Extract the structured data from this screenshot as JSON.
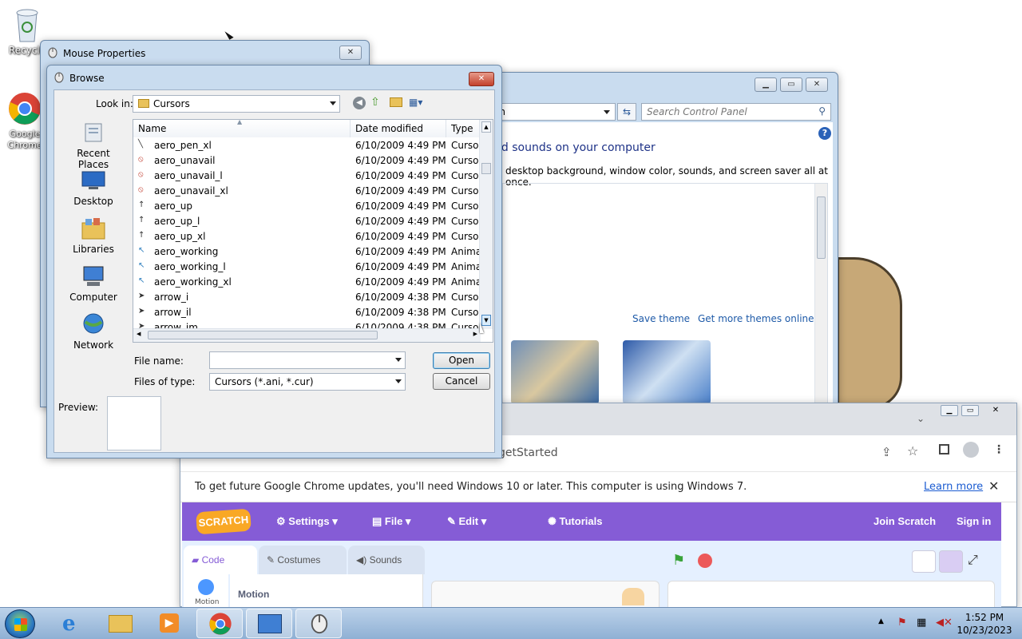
{
  "desktop": {
    "icons": [
      {
        "label": "Recycle"
      },
      {
        "label": "Google Chrome"
      }
    ]
  },
  "control_panel": {
    "address_text": "on",
    "search_placeholder": "Search Control Panel",
    "heading": "nd sounds on your computer",
    "subtext": "desktop background, window color, sounds, and screen saver all at once.",
    "save_theme": "Save theme",
    "more_themes": "Get more themes online"
  },
  "mouse_properties": {
    "title": "Mouse Properties"
  },
  "browse": {
    "title": "Browse",
    "look_in_label": "Look in:",
    "look_in_value": "Cursors",
    "places": [
      "Recent Places",
      "Desktop",
      "Libraries",
      "Computer",
      "Network"
    ],
    "columns": {
      "name": "Name",
      "date": "Date modified",
      "type": "Type"
    },
    "files": [
      {
        "name": "aero_pen_xl",
        "date": "6/10/2009 4:49 PM",
        "type": "Cursor",
        "icon": "pen-cursor-icon"
      },
      {
        "name": "aero_unavail",
        "date": "6/10/2009 4:49 PM",
        "type": "Cursor",
        "icon": "unavailable-cursor-icon"
      },
      {
        "name": "aero_unavail_l",
        "date": "6/10/2009 4:49 PM",
        "type": "Cursor",
        "icon": "unavailable-cursor-icon"
      },
      {
        "name": "aero_unavail_xl",
        "date": "6/10/2009 4:49 PM",
        "type": "Cursor",
        "icon": "unavailable-cursor-icon"
      },
      {
        "name": "aero_up",
        "date": "6/10/2009 4:49 PM",
        "type": "Cursor",
        "icon": "up-arrow-cursor-icon"
      },
      {
        "name": "aero_up_l",
        "date": "6/10/2009 4:49 PM",
        "type": "Cursor",
        "icon": "up-arrow-cursor-icon"
      },
      {
        "name": "aero_up_xl",
        "date": "6/10/2009 4:49 PM",
        "type": "Cursor",
        "icon": "up-arrow-cursor-icon"
      },
      {
        "name": "aero_working",
        "date": "6/10/2009 4:49 PM",
        "type": "Anima",
        "icon": "working-cursor-icon"
      },
      {
        "name": "aero_working_l",
        "date": "6/10/2009 4:49 PM",
        "type": "Anima",
        "icon": "working-cursor-icon"
      },
      {
        "name": "aero_working_xl",
        "date": "6/10/2009 4:49 PM",
        "type": "Anima",
        "icon": "working-cursor-icon"
      },
      {
        "name": "arrow_i",
        "date": "6/10/2009 4:38 PM",
        "type": "Cursor",
        "icon": "arrow-cursor-icon"
      },
      {
        "name": "arrow_il",
        "date": "6/10/2009 4:38 PM",
        "type": "Cursor",
        "icon": "arrow-cursor-icon"
      },
      {
        "name": "arrow_im",
        "date": "6/10/2009 4:38 PM",
        "type": "Cursor",
        "icon": "arrow-cursor-icon"
      }
    ],
    "file_name_label": "File name:",
    "file_name_value": "",
    "files_of_type_label": "Files of type:",
    "files_of_type_value": "Cursors (*.ani, *.cur)",
    "open_label": "Open",
    "cancel_label": "Cancel",
    "preview_label": "Preview:"
  },
  "chrome": {
    "url_tail": "getStarted",
    "infobar_message": "To get future Google Chrome updates, you'll need Windows 10 or later. This computer is using Windows 7.",
    "learn_more": "Learn more",
    "close_symbol": "✕"
  },
  "scratch": {
    "logo": "SCRATCH",
    "menu": [
      "Settings",
      "File",
      "Edit",
      "Tutorials"
    ],
    "join": "Join Scratch",
    "sign_in": "Sign in",
    "tabs": [
      "Code",
      "Costumes",
      "Sounds"
    ],
    "category": "Motion",
    "palette_heading": "Motion",
    "accent_color": "#855cd6"
  },
  "taskbar": {
    "time": "1:52 PM",
    "date": "10/23/2023"
  }
}
